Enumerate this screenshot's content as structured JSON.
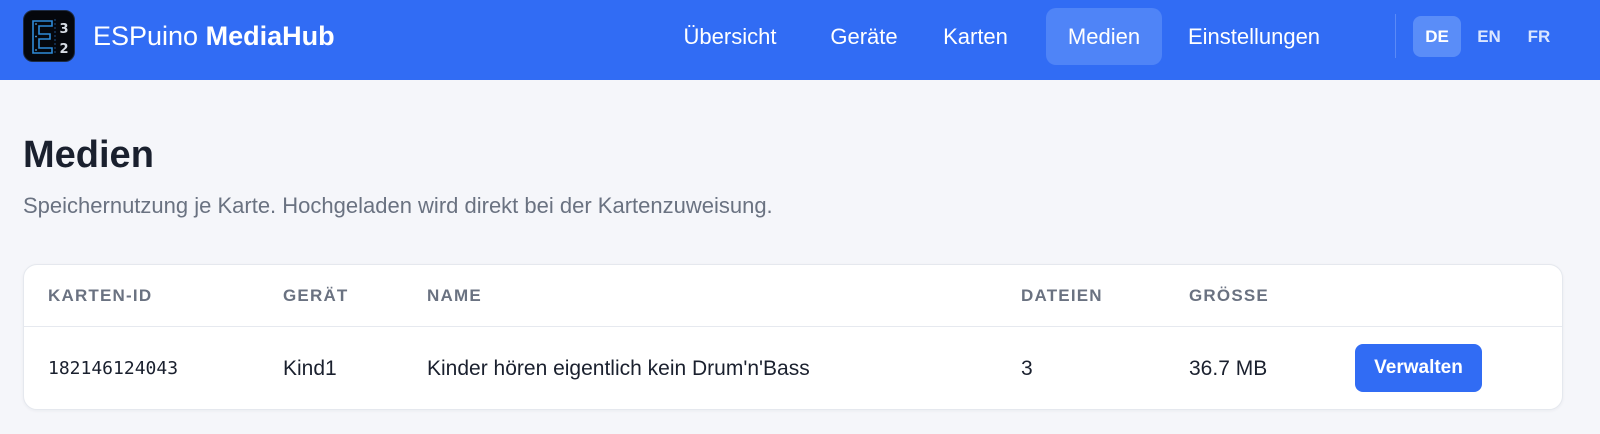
{
  "header": {
    "brand_light": "ESPuino",
    "brand_bold": "MediaHub",
    "logo": {
      "icon": "esp32-chip-logo",
      "glyph_main": "E",
      "glyph_top": "3",
      "glyph_bottom": "2"
    },
    "nav": [
      {
        "label": "Übersicht",
        "active": false
      },
      {
        "label": "Geräte",
        "active": false
      },
      {
        "label": "Karten",
        "active": false
      },
      {
        "label": "Medien",
        "active": true
      },
      {
        "label": "Einstellungen",
        "active": false
      }
    ],
    "languages": [
      {
        "label": "DE",
        "active": true
      },
      {
        "label": "EN",
        "active": false
      },
      {
        "label": "FR",
        "active": false
      }
    ]
  },
  "page": {
    "title": "Medien",
    "subtitle": "Speichernutzung je Karte. Hochgeladen wird direkt bei der Kartenzuweisung."
  },
  "table": {
    "columns": [
      "KARTEN-ID",
      "GERÄT",
      "NAME",
      "DATEIEN",
      "GRÖSSE",
      ""
    ],
    "rows": [
      {
        "card_id": "182146124043",
        "device": "Kind1",
        "name": "Kinder hören eigentlich kein Drum'n'Bass",
        "files": "3",
        "size": "36.7 MB",
        "action_label": "Verwalten"
      }
    ]
  },
  "colors": {
    "header_bg": "#316cf4",
    "nav_active_bg": "#4f84f7",
    "page_bg": "#f5f6fa",
    "primary_button": "#316cf4",
    "heading_text": "#1a202e",
    "muted_text": "#6a7281"
  }
}
